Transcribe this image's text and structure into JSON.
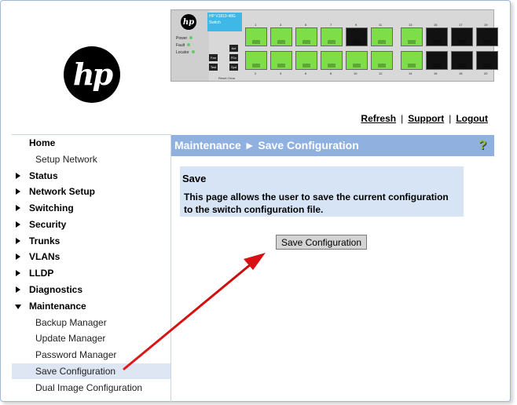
{
  "logo_text": "hp",
  "switch": {
    "logo_text": "hp",
    "model_label": "HP V1810-48G Switch",
    "leds": [
      "Power",
      "Fault",
      "Locator"
    ],
    "buttons": [
      "Act",
      "FDx",
      "Spd",
      "Fan",
      "Test"
    ],
    "port_numbers_top": [
      "1",
      "3",
      "5",
      "7",
      "9",
      "11",
      "13",
      "15",
      "17",
      "19"
    ],
    "port_numbers_bottom": [
      "2",
      "4",
      "6",
      "8",
      "10",
      "12",
      "14",
      "16",
      "18",
      "20"
    ],
    "legend": "Reset  Clear"
  },
  "toplinks": {
    "refresh": "Refresh",
    "support": "Support",
    "logout": "Logout",
    "sep": "|"
  },
  "nav": {
    "home": "Home",
    "setup_network": "Setup Network",
    "status": "Status",
    "network_setup": "Network Setup",
    "switching": "Switching",
    "security": "Security",
    "trunks": "Trunks",
    "vlans": "VLANs",
    "lldp": "LLDP",
    "diagnostics": "Diagnostics",
    "maintenance": "Maintenance",
    "backup_manager": "Backup Manager",
    "update_manager": "Update Manager",
    "password_manager": "Password Manager",
    "save_configuration": "Save Configuration",
    "dual_image_configuration": "Dual Image Configuration"
  },
  "title": "Maintenance ► Save Configuration",
  "help_icon": "?",
  "panel": {
    "heading": "Save",
    "description": "This page allows the user to save the current configuration to the switch configuration file."
  },
  "save_button": "Save Configuration",
  "colors": {
    "titlebar": "#90b0e0",
    "panel": "#d6e4f6",
    "active_nav": "#dde6f2",
    "annotation_arrow": "#dd1111"
  }
}
